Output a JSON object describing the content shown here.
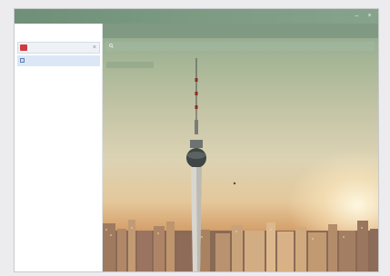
{
  "window": {
    "title": "",
    "minimize_glyph": "–",
    "close_glyph": "×"
  },
  "sidebar": {
    "notebook": {
      "label": "",
      "close_glyph": "×",
      "color": "#d23b3b"
    },
    "section": {
      "label": ""
    }
  },
  "main": {
    "page_title": "",
    "search_placeholder": "",
    "tag_label": ""
  },
  "colors": {
    "title_bar": "#7c9b82",
    "accent_red": "#d23b3b",
    "selection": "#dbe7f5"
  },
  "icons": [
    "notebook-icon",
    "section-icon",
    "search-icon",
    "minimize-icon",
    "close-icon"
  ]
}
